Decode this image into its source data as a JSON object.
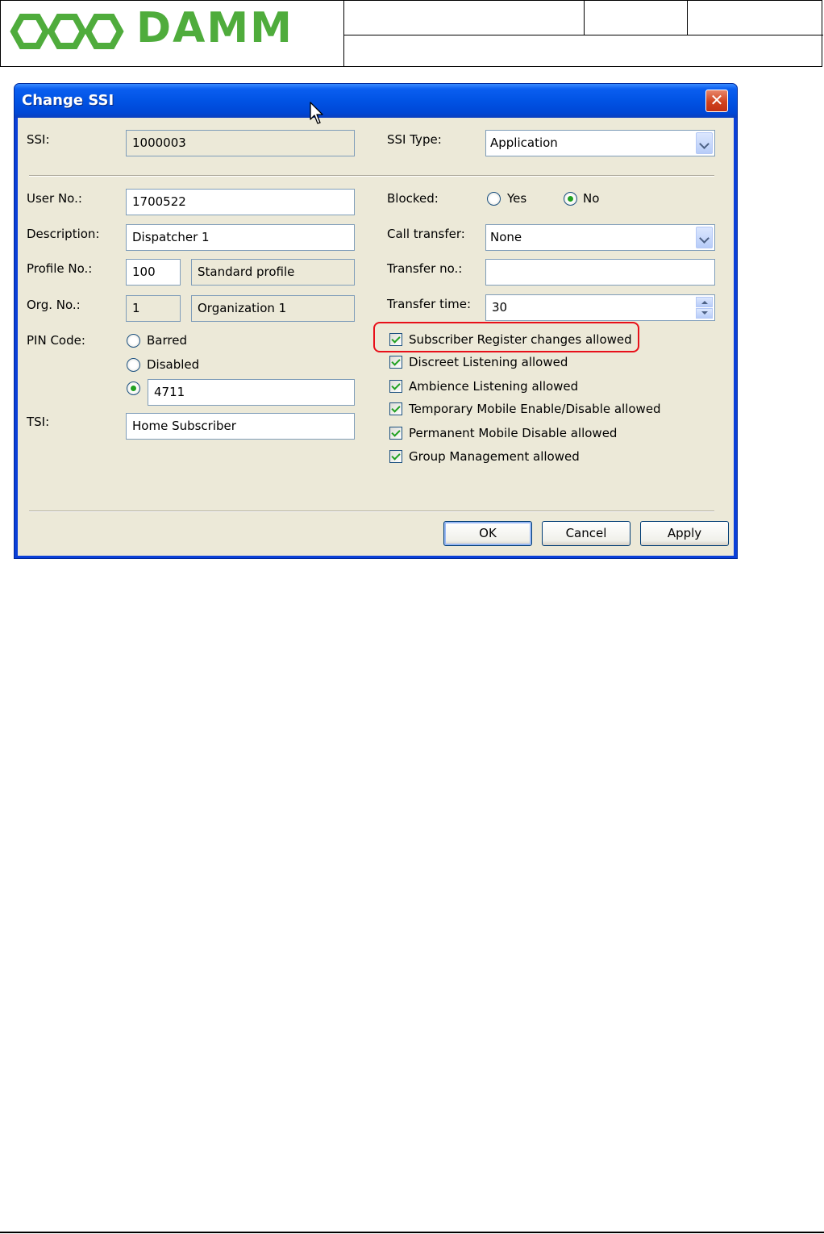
{
  "header": {
    "logo_text": "DAMM",
    "brand_color": "#4fac3c"
  },
  "dialog": {
    "title": "Change SSI",
    "close_icon": "close-icon",
    "ssi_label": "SSI:",
    "ssi_value": "1000003",
    "ssi_type_label": "SSI Type:",
    "ssi_type_value": "Application",
    "user_no_label": "User No.:",
    "user_no_value": "1700522",
    "description_label": "Description:",
    "description_value": "Dispatcher 1",
    "profile_no_label": "Profile No.:",
    "profile_no_value": "100",
    "profile_name_value": "Standard profile",
    "org_no_label": "Org. No.:",
    "org_no_value": "1",
    "org_name_value": "Organization 1",
    "pin_code_label": "PIN Code:",
    "pin_options": {
      "barred": "Barred",
      "disabled": "Disabled"
    },
    "pin_selected": "custom",
    "pin_value": "4711",
    "tsi_label": "TSI:",
    "tsi_value": "Home Subscriber",
    "blocked_label": "Blocked:",
    "blocked_yes": "Yes",
    "blocked_no": "No",
    "blocked_selected": "No",
    "call_transfer_label": "Call transfer:",
    "call_transfer_value": "None",
    "transfer_no_label": "Transfer no.:",
    "transfer_no_value": "",
    "transfer_time_label": "Transfer time:",
    "transfer_time_value": "30",
    "checkboxes": [
      {
        "label": "Subscriber Register changes allowed",
        "checked": true
      },
      {
        "label": "Discreet Listening allowed",
        "checked": true
      },
      {
        "label": "Ambience Listening allowed",
        "checked": true
      },
      {
        "label": "Temporary Mobile Enable/Disable allowed",
        "checked": true
      },
      {
        "label": "Permanent Mobile Disable allowed",
        "checked": true
      },
      {
        "label": "Group Management allowed",
        "checked": true
      }
    ],
    "buttons": {
      "ok": "OK",
      "cancel": "Cancel",
      "apply": "Apply"
    },
    "highlight_color": "#e8101a"
  }
}
